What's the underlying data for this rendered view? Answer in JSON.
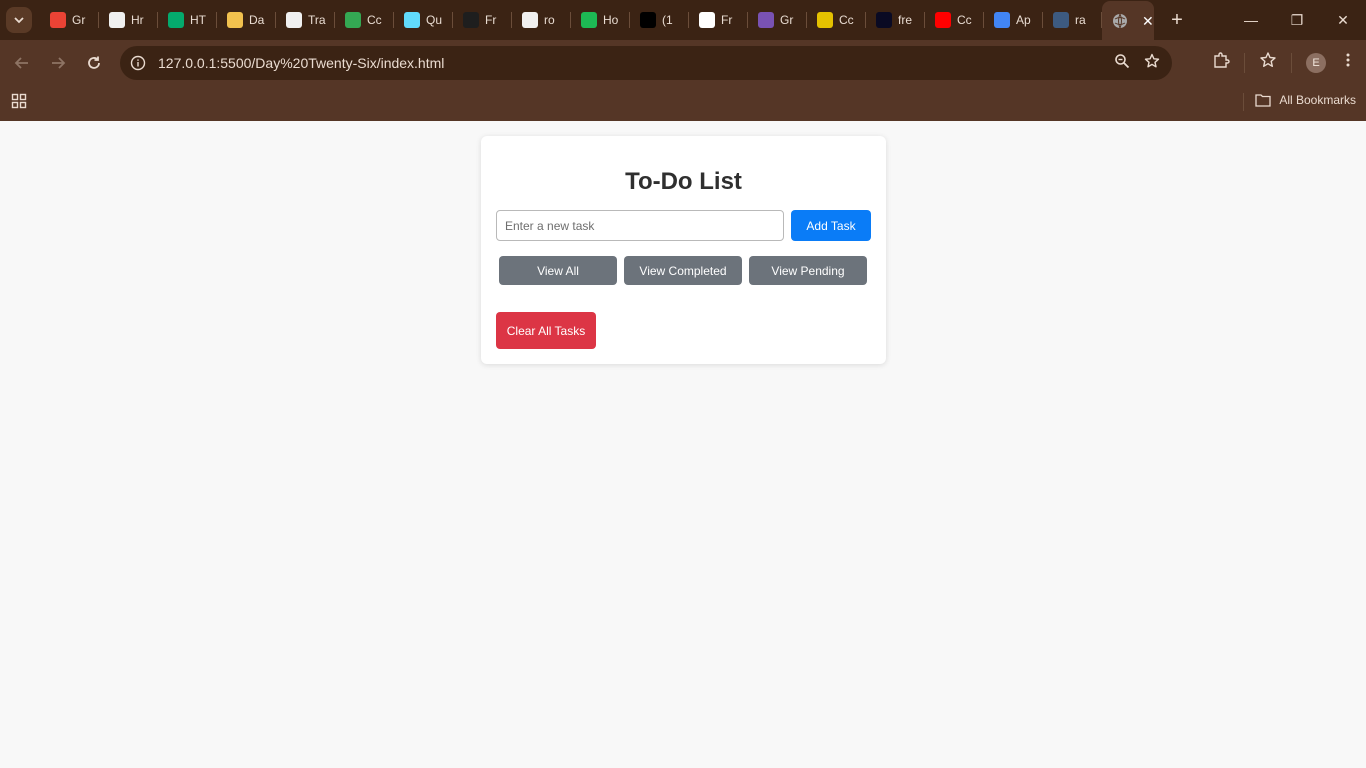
{
  "browser": {
    "tabs": [
      {
        "label": "Gr",
        "icon": "gmail-icon",
        "color": "#ea4335"
      },
      {
        "label": "Hr",
        "icon": "github-icon",
        "color": "#f0f0f0"
      },
      {
        "label": "HT",
        "icon": "w3schools-icon",
        "color": "#04aa6d"
      },
      {
        "label": "Da",
        "icon": "fox-icon",
        "color": "#f2c14e"
      },
      {
        "label": "Tra",
        "icon": "codepen-icon",
        "color": "#f0f0f0"
      },
      {
        "label": "Cc",
        "icon": "drive-icon",
        "color": "#34a853"
      },
      {
        "label": "Qu",
        "icon": "react-icon",
        "color": "#61dafb"
      },
      {
        "label": "Fr",
        "icon": "framer-icon",
        "color": "#1e1e1e"
      },
      {
        "label": "ro",
        "icon": "github-icon",
        "color": "#f0f0f0"
      },
      {
        "label": "Ho",
        "icon": "spotify-icon",
        "color": "#1db954"
      },
      {
        "label": "(1",
        "icon": "x-icon",
        "color": "#000000"
      },
      {
        "label": "Fr",
        "icon": "page-icon",
        "color": "#ffffff"
      },
      {
        "label": "Gr",
        "icon": "bootstrap-icon",
        "color": "#7952b3"
      },
      {
        "label": "Cc",
        "icon": "canva-icon",
        "color": "#e5c100"
      },
      {
        "label": "fre",
        "icon": "freecodecamp-icon",
        "color": "#0a0a23"
      },
      {
        "label": "Cc",
        "icon": "youtube-icon",
        "color": "#ff0000"
      },
      {
        "label": "Ap",
        "icon": "app-icon",
        "color": "#4285f4"
      },
      {
        "label": "ra",
        "icon": "loading-icon",
        "color": "#3d5a80"
      }
    ],
    "active_tab": {
      "icon": "globe-icon",
      "close": "✕"
    },
    "new_tab": "+",
    "window_controls": {
      "minimize": "—",
      "restore": "❐",
      "close": "✕"
    },
    "url": "127.0.0.1:5500/Day%20Twenty-Six/index.html",
    "avatar_letter": "E",
    "all_bookmarks": "All Bookmarks"
  },
  "app": {
    "title": "To-Do List",
    "input_placeholder": "Enter a new task",
    "add_label": "Add Task",
    "filters": [
      "View All",
      "View Completed",
      "View Pending"
    ],
    "clear_label": "Clear All Tasks",
    "colors": {
      "primary": "#0a7cf7",
      "secondary": "#6c737b",
      "danger": "#dc3545"
    }
  }
}
